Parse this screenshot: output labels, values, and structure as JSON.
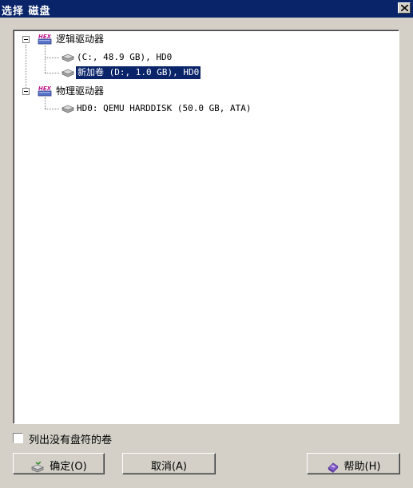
{
  "window": {
    "title": "选择 磁盘"
  },
  "tree": {
    "logical_group": {
      "label": "逻辑驱动器"
    },
    "logical_items": [
      {
        "label": " (C:, 48.9 GB), HD0"
      },
      {
        "label": "新加卷 (D:, 1.0 GB), HD0",
        "selected": true
      }
    ],
    "physical_group": {
      "label": "物理驱动器"
    },
    "physical_items": [
      {
        "label": "HD0: QEMU HARDDISK (50.0 GB, ATA)"
      }
    ]
  },
  "options": {
    "list_no_letter_label": "列出没有盘符的卷",
    "checked": false
  },
  "buttons": {
    "ok_label": "确定(O)",
    "cancel_label": "取消(A)",
    "help_label": "帮助(H)"
  },
  "colors": {
    "titlebar": "#0a246a",
    "selection": "#0a246a",
    "dialog_bg": "#d4d0c8"
  },
  "icons": [
    "hex-drive-icon",
    "hard-disk-icon",
    "close-icon",
    "ok-icon",
    "help-icon"
  ]
}
